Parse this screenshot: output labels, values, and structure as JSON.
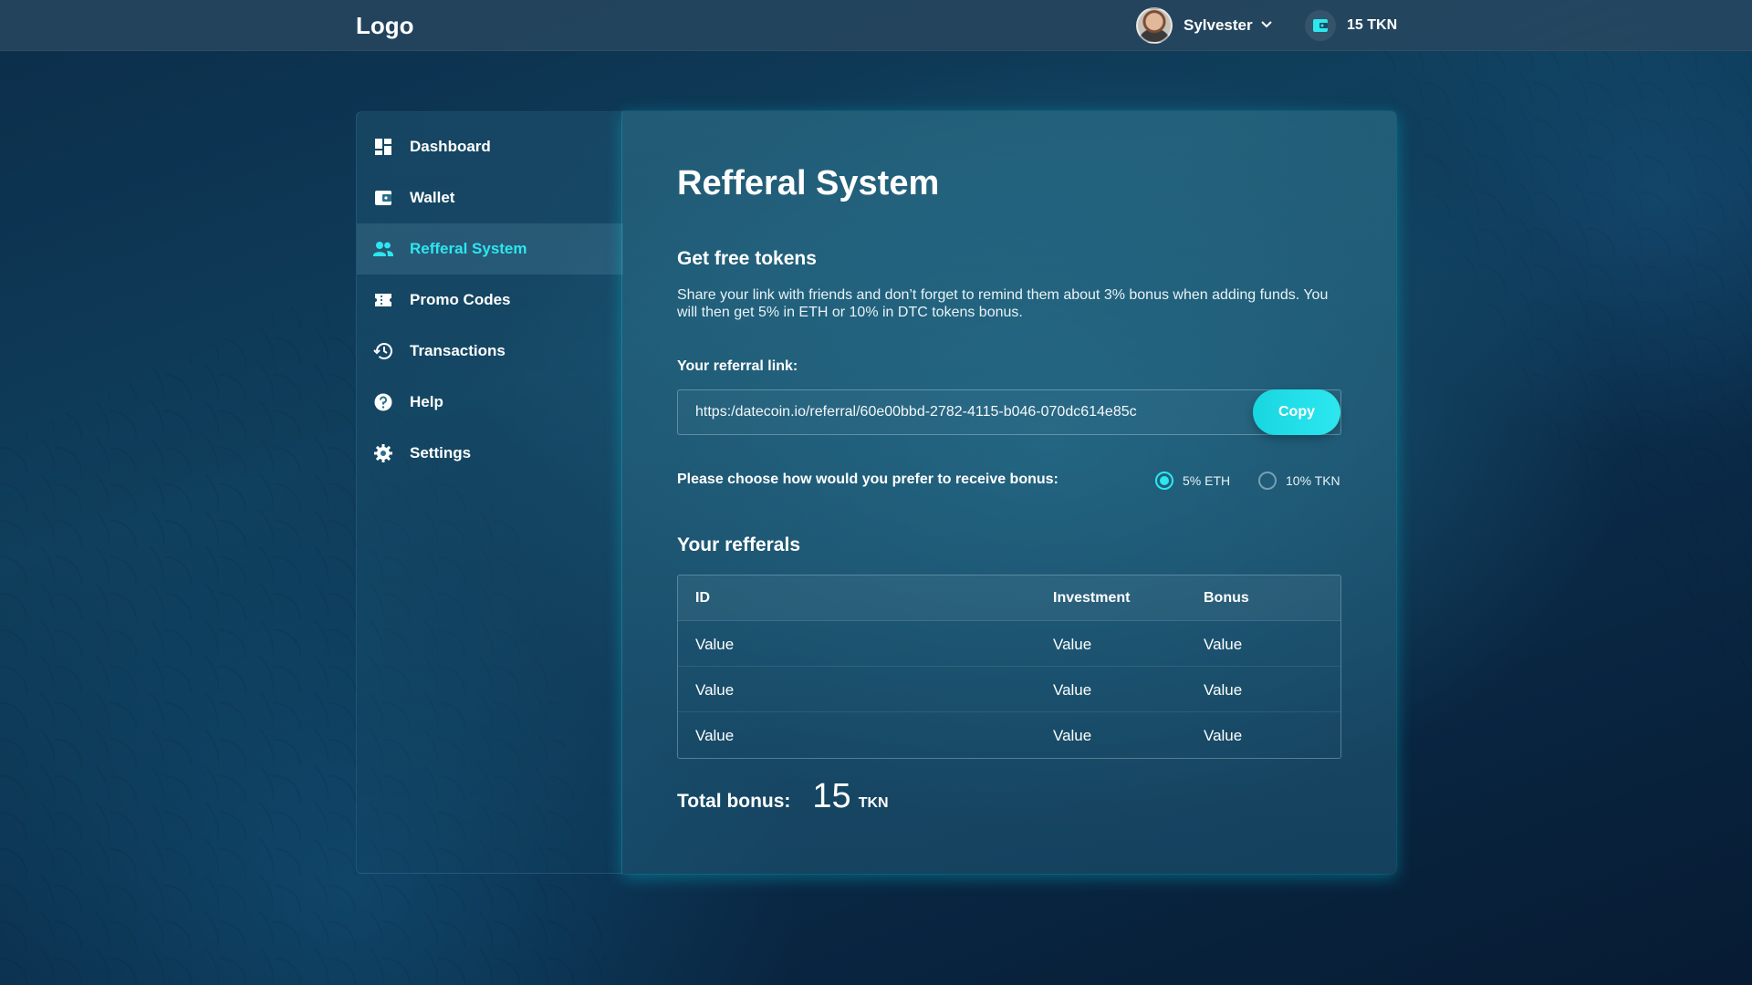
{
  "header": {
    "logo": "Logo",
    "user_name": "Sylvester",
    "balance": "15 TKN"
  },
  "sidebar": {
    "items": [
      {
        "label": "Dashboard",
        "icon": "dashboard-icon"
      },
      {
        "label": "Wallet",
        "icon": "wallet-icon"
      },
      {
        "label": "Refferal System",
        "icon": "people-icon",
        "active": true
      },
      {
        "label": "Promo Codes",
        "icon": "ticket-icon"
      },
      {
        "label": "Transactions",
        "icon": "history-icon"
      },
      {
        "label": "Help",
        "icon": "help-icon"
      },
      {
        "label": "Settings",
        "icon": "gear-icon"
      }
    ]
  },
  "main": {
    "title": "Refferal System",
    "free_tokens_heading": "Get free tokens",
    "description": "Share your link with friends and don’t forget to remind them about 3% bonus when adding funds. You will then get 5% in ETH or 10% in DTC tokens bonus.",
    "referral_link_label": "Your referral link:",
    "referral_link": "https:/datecoin.io/referral/60e00bbd-2782-4115-b046-070dc614e85c",
    "copy_label": "Copy",
    "bonus_prompt": "Please choose how would you prefer to receive bonus:",
    "bonus_options": [
      {
        "label": "5% ETH",
        "selected": true
      },
      {
        "label": "10% TKN",
        "selected": false
      }
    ],
    "referrals_heading": "Your refferals",
    "table": {
      "headers": [
        "ID",
        "Investment",
        "Bonus"
      ],
      "rows": [
        [
          "Value",
          "Value",
          "Value"
        ],
        [
          "Value",
          "Value",
          "Value"
        ],
        [
          "Value",
          "Value",
          "Value"
        ]
      ]
    },
    "total_label": "Total bonus:",
    "total_value": "15",
    "total_unit": "TKN"
  },
  "colors": {
    "accent": "#2de7ef",
    "background": "#0b2d4a"
  }
}
